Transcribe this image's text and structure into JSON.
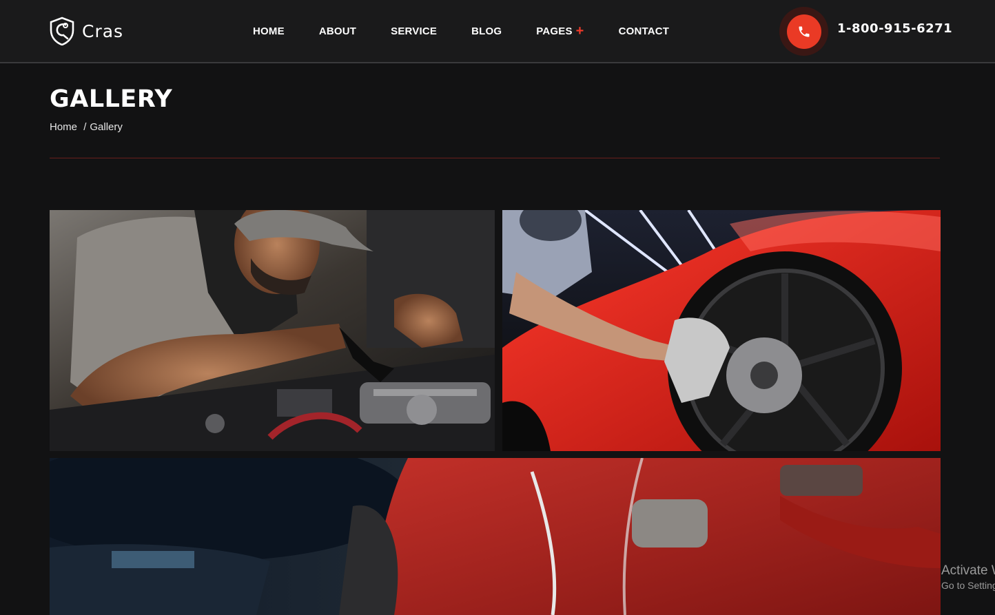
{
  "header": {
    "logo_text": "Cras",
    "logo_icon": "shield-wrench-icon",
    "phone_icon": "phone-icon",
    "phone_number": "1-800-915-6271",
    "accent_color": "#ea3a25"
  },
  "nav": {
    "items": [
      {
        "label": "HOME"
      },
      {
        "label": "ABOUT"
      },
      {
        "label": "SERVICE"
      },
      {
        "label": "BLOG"
      },
      {
        "label": "PAGES",
        "icon": "plus-icon"
      },
      {
        "label": "CONTACT"
      }
    ]
  },
  "page": {
    "title": "GALLERY",
    "breadcrumb": {
      "home": "Home",
      "separator": "/",
      "current": "Gallery"
    }
  },
  "gallery": {
    "images": [
      {
        "subject": "mechanic-engine-photo"
      },
      {
        "subject": "red-car-wheel-cleaning-photo"
      },
      {
        "subject": "mechanic-red-jacket-photo"
      }
    ]
  },
  "os_watermark": {
    "line1": "Activate Windows",
    "line2": "Go to Settings to activate Windows."
  }
}
